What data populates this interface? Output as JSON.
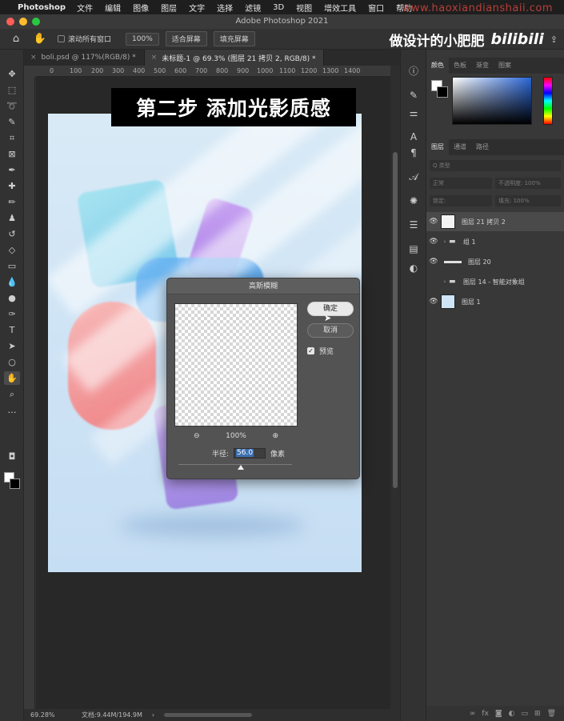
{
  "menubar": {
    "app_name": "Photoshop",
    "items": [
      "文件",
      "编辑",
      "图像",
      "图层",
      "文字",
      "选择",
      "滤镜",
      "3D",
      "视图",
      "增效工具",
      "窗口",
      "帮助"
    ],
    "watermark": "www.haoxiandianshaii.com"
  },
  "window": {
    "title": "Adobe Photoshop 2021"
  },
  "options": {
    "scroll_all": "滚动所有窗口",
    "zoom_100": "100%",
    "fit_screen": "适合屏幕",
    "fill_screen": "填充屏幕"
  },
  "brand": {
    "text": "做设计的小肥肥",
    "logo": "bilibili"
  },
  "tabs": [
    {
      "label": "boli.psd @ 117%(RGB/8) *",
      "active": false
    },
    {
      "label": "未标题-1 @ 69.3% (图层 21 拷贝 2, RGB/8) *",
      "active": true
    }
  ],
  "ruler": {
    "ticks": [
      "0",
      "100",
      "200",
      "300",
      "400",
      "500",
      "600",
      "700",
      "800",
      "900",
      "1000",
      "1100",
      "1200",
      "1300",
      "1400"
    ]
  },
  "banner": {
    "text": "第二步 添加光影质感"
  },
  "dialog": {
    "title": "高斯模糊",
    "ok": "确定",
    "cancel": "取消",
    "preview": "预览",
    "zoom": "100%",
    "radius_label": "半径:",
    "radius_value": "56.0",
    "unit": "像素",
    "slider_level": 0.55
  },
  "status": {
    "zoom": "69.28%",
    "doc": "文档:9.44M/194.9M"
  },
  "panels": {
    "color_tabs": [
      "颜色",
      "色板",
      "渐变",
      "图案"
    ],
    "layer_tabs": [
      "图层",
      "通道",
      "路径"
    ],
    "kind_placeholder": "Q 类型",
    "blend_mode": "正常",
    "opacity": "不透明度: 100%",
    "lock": "锁定:",
    "fill": "填充: 100%",
    "layers": [
      {
        "name": "图层 21 拷贝 2",
        "type": "smart",
        "visible": true,
        "selected": true
      },
      {
        "name": "组 1",
        "type": "group",
        "visible": true,
        "selected": false
      },
      {
        "name": "图层 20",
        "type": "line",
        "visible": true,
        "selected": false
      },
      {
        "name": "图层 14 - 智能对象组",
        "type": "group",
        "visible": false,
        "selected": false
      },
      {
        "name": "图层 1",
        "type": "fill",
        "visible": true,
        "selected": false
      }
    ]
  },
  "colors": {
    "accent": "#3c6fb0",
    "artboard": "#cfe4f5"
  }
}
